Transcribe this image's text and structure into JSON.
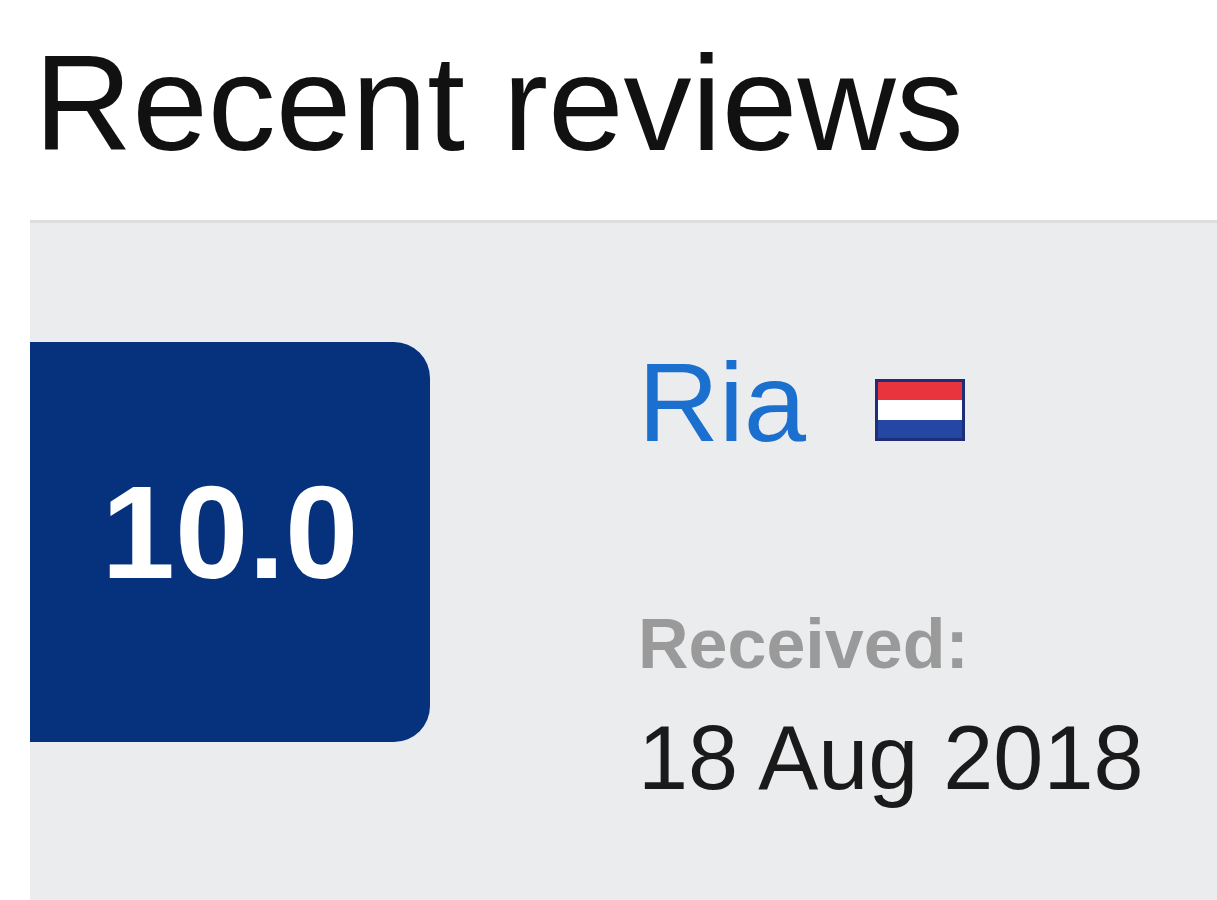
{
  "heading": "Recent reviews",
  "reviews": [
    {
      "score": "10.0",
      "reviewer": "Ria",
      "received_label": "Received:",
      "received_date": "18 Aug 2018"
    }
  ]
}
